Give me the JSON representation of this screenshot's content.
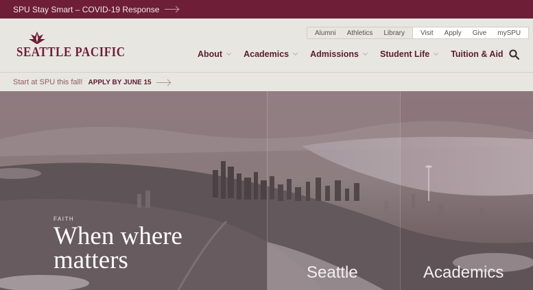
{
  "alert": {
    "text": "SPU Stay Smart – COVID-19 Response"
  },
  "logo": {
    "text": "SEATTLE PACIFIC"
  },
  "utility_nav": {
    "left": [
      "Alumni",
      "Athletics",
      "Library"
    ],
    "right": [
      "Visit",
      "Apply",
      "Give",
      "mySPU"
    ]
  },
  "main_nav": [
    {
      "label": "About",
      "has_dropdown": true
    },
    {
      "label": "Academics",
      "has_dropdown": true
    },
    {
      "label": "Admissions",
      "has_dropdown": true
    },
    {
      "label": "Student Life",
      "has_dropdown": true
    },
    {
      "label": "Tuition & Aid",
      "has_dropdown": false
    }
  ],
  "promo": {
    "text": "Start at SPU this fall!",
    "cta": "APPLY BY JUNE 15"
  },
  "hero": {
    "eyebrow": "FAITH",
    "headline": "When where matters",
    "panels": [
      "Seattle",
      "Academics"
    ]
  },
  "colors": {
    "brand_maroon": "#6e1e37",
    "nav_text": "#5a1b30",
    "header_bg": "#e8e6e1"
  },
  "icons": {
    "search": "search-icon",
    "logo_mark": "flame-logo-icon"
  }
}
